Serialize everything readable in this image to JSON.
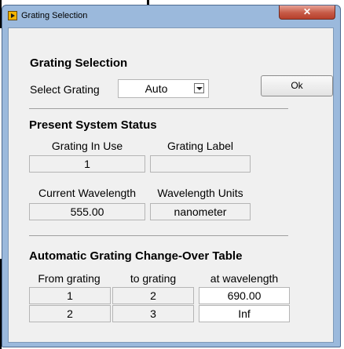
{
  "window": {
    "title": "Grating Selection",
    "close_glyph": "✕"
  },
  "grating_selection": {
    "heading": "Grating Selection",
    "select_label": "Select Grating",
    "select_value": "Auto",
    "ok_label": "Ok"
  },
  "status": {
    "heading": "Present System Status",
    "grating_in_use_label": "Grating In Use",
    "grating_in_use_value": "1",
    "grating_label_label": "Grating Label",
    "grating_label_value": "",
    "current_wavelength_label": "Current Wavelength",
    "current_wavelength_value": "555.00",
    "wavelength_units_label": "Wavelength Units",
    "wavelength_units_value": "nanometer"
  },
  "changeover": {
    "heading": "Automatic Grating Change-Over Table",
    "columns": [
      "From grating",
      "to grating",
      "at wavelength"
    ],
    "rows": [
      [
        "1",
        "2",
        "690.00"
      ],
      [
        "2",
        "3",
        "Inf"
      ]
    ]
  }
}
